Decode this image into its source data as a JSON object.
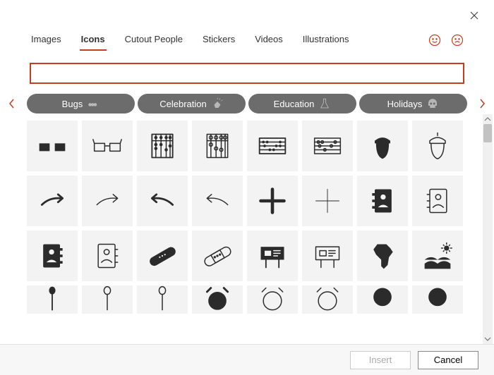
{
  "tabs": [
    "Images",
    "Icons",
    "Cutout People",
    "Stickers",
    "Videos",
    "Illustrations"
  ],
  "active_tab": "Icons",
  "search": {
    "value": "",
    "placeholder": ""
  },
  "categories": [
    {
      "label": "Bugs",
      "icon": "bug"
    },
    {
      "label": "Celebration",
      "icon": "clap"
    },
    {
      "label": "Education",
      "icon": "flask"
    },
    {
      "label": "Holidays",
      "icon": "skull"
    }
  ],
  "footer": {
    "insert": "Insert",
    "cancel": "Cancel",
    "insert_enabled": false
  },
  "icons": [
    [
      "glasses-3d-solid",
      "glasses-3d-outline",
      "abacus-solid",
      "abacus-outline",
      "abacus-beads-solid",
      "abacus-beads-outline",
      "acorn-solid",
      "acorn-outline"
    ],
    [
      "arrow-curve-right-solid",
      "arrow-curve-right-outline",
      "arrow-curve-left-solid",
      "arrow-curve-left-outline",
      "plus-bold",
      "plus-thin",
      "address-book-solid",
      "address-book-outline"
    ],
    [
      "address-book-left-solid",
      "address-book-left-outline",
      "bandage-solid",
      "bandage-outline",
      "billboard-solid",
      "billboard-outline",
      "africa-solid",
      "agriculture-solid"
    ],
    [
      "pin-solid",
      "pin-outline",
      "pin-mid",
      "clock-solid",
      "clock-outline",
      "clock-mid",
      "blob-a",
      "blob-b"
    ]
  ]
}
